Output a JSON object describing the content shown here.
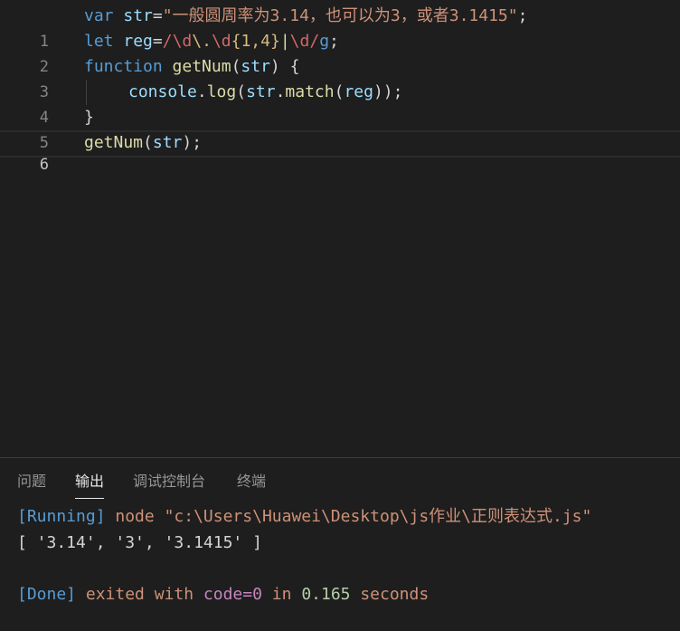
{
  "editor": {
    "line_numbers": [
      "1",
      "2",
      "3",
      "4",
      "5",
      "6"
    ],
    "line1": {
      "kw": "var",
      "name": " str",
      "eq": "=",
      "value": "\"一般圆周率为3.14，也可以为3，或者3.1415\"",
      "end": ";"
    },
    "line2": {
      "kw": "let",
      "name": " reg",
      "eq": "=",
      "slash1": "/",
      "esc1": "\\d",
      "esc2": "\\.",
      "esc3": "\\d",
      "quant": "{1,4}",
      "alt": "|",
      "esc4": "\\d",
      "slash2": "/",
      "flag": "g",
      "end": ";"
    },
    "line3": {
      "kw": "function",
      "fname": " getNum",
      "open": "(",
      "param": "str",
      "close": ") {"
    },
    "line4": {
      "obj": "console",
      "dot": ".",
      "method": "log",
      "p1": "(",
      "arg": "str",
      "dot2": ".",
      "method2": "match",
      "p2": "(",
      "arg2": "reg",
      "end": "));"
    },
    "line5": {
      "text": "}"
    },
    "line6": {
      "fname": "getNum",
      "open": "(",
      "arg": "str",
      "end": ");"
    }
  },
  "panel": {
    "tabs": [
      "问题",
      "输出",
      "调试控制台",
      "终端"
    ],
    "active_tab": "输出",
    "output": {
      "running_tag": "[Running]",
      "running_cmd": " node \"c:\\Users\\Huawei\\Desktop\\js作业\\正则表达式.js\"",
      "result": "[ '3.14', '3', '3.1415' ]",
      "done_tag": "[Done]",
      "exited": " exited with ",
      "code": "code=0",
      "in": " in ",
      "time": "0.165",
      "seconds": " seconds"
    }
  }
}
